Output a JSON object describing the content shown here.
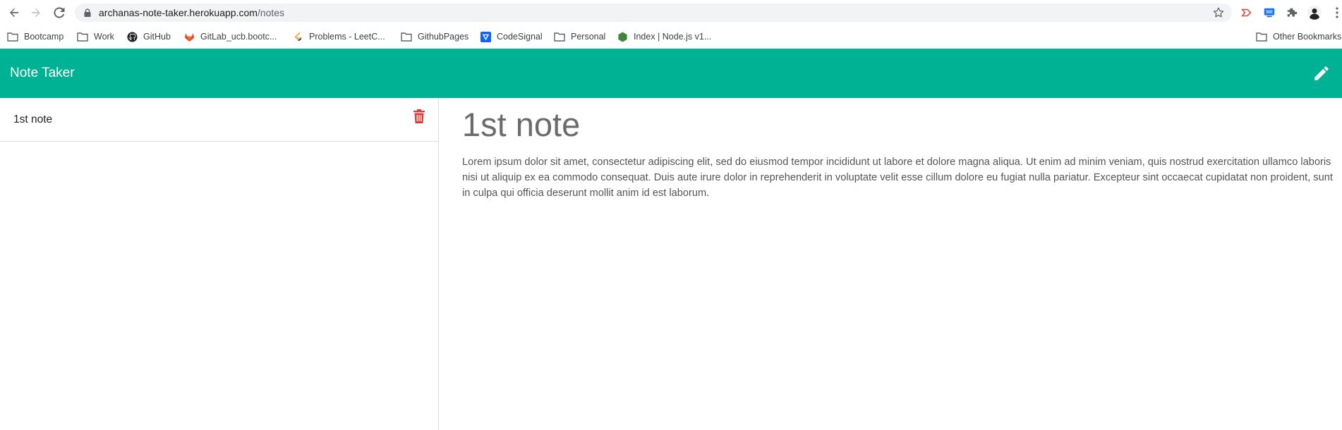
{
  "browser": {
    "url_host": "archanas-note-taker.herokuapp.com",
    "url_path": "/notes",
    "bookmarks": [
      {
        "label": "Bootcamp",
        "icon": "folder-icon"
      },
      {
        "label": "Work",
        "icon": "folder-icon"
      },
      {
        "label": "GitHub",
        "icon": "github-icon"
      },
      {
        "label": "GitLab_ucb.bootc...",
        "icon": "gitlab-icon"
      },
      {
        "label": "Problems - LeetC...",
        "icon": "leetcode-icon"
      },
      {
        "label": "GithubPages",
        "icon": "folder-icon"
      },
      {
        "label": "CodeSignal",
        "icon": "codesignal-icon"
      },
      {
        "label": "Personal",
        "icon": "folder-icon"
      },
      {
        "label": "Index | Node.js v1...",
        "icon": "nodejs-icon"
      }
    ],
    "other_bookmarks": "Other Bookmarks"
  },
  "app": {
    "title": "Note Taker",
    "accent": "#00b294"
  },
  "notes": [
    {
      "title": "1st note"
    }
  ],
  "active_note": {
    "title": "1st note",
    "text": "Lorem ipsum dolor sit amet, consectetur adipiscing elit, sed do eiusmod tempor incididunt ut labore et dolore magna aliqua. Ut enim ad minim veniam, quis nostrud exercitation ullamco laboris nisi ut aliquip ex ea commodo consequat. Duis aute irure dolor in reprehenderit in voluptate velit esse cillum dolore eu fugiat nulla pariatur. Excepteur sint occaecat cupidatat non proident, sunt in culpa qui officia deserunt mollit anim id est laborum."
  }
}
